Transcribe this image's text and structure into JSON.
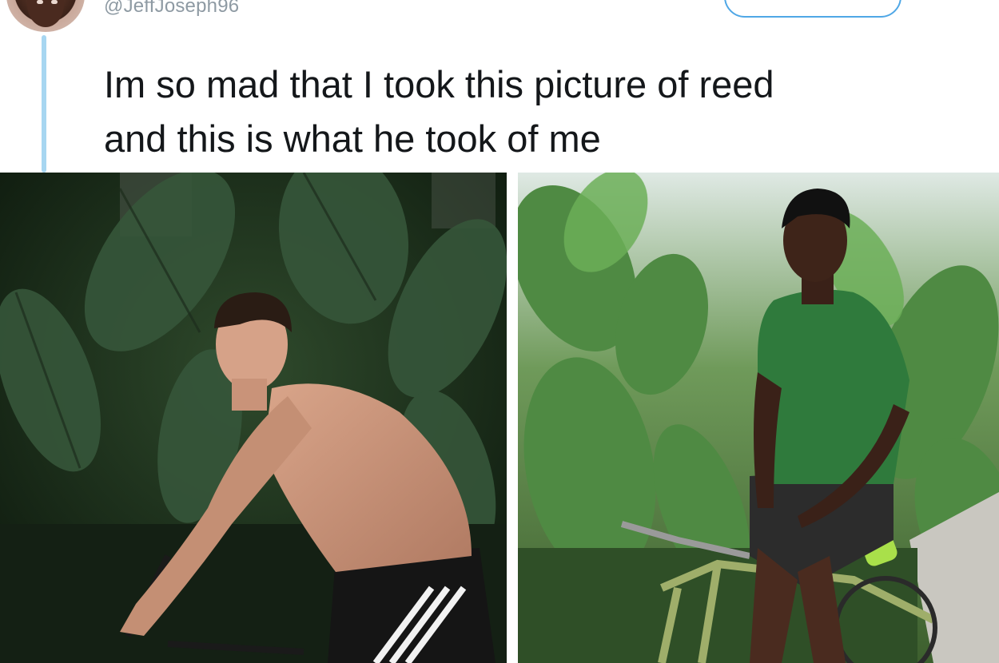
{
  "tweet": {
    "handle": "@JeffJoseph96",
    "text_line1": "Im so mad that I took this picture of reed",
    "text_line2": "and this is what he took of me"
  },
  "icons": {
    "avatar": "user-avatar",
    "thread_line": "thread-connector"
  },
  "colors": {
    "thread_line": "#a7d6f1",
    "follow_border": "#4fa7e6",
    "handle": "#8e9aa3",
    "text": "#14171a"
  }
}
